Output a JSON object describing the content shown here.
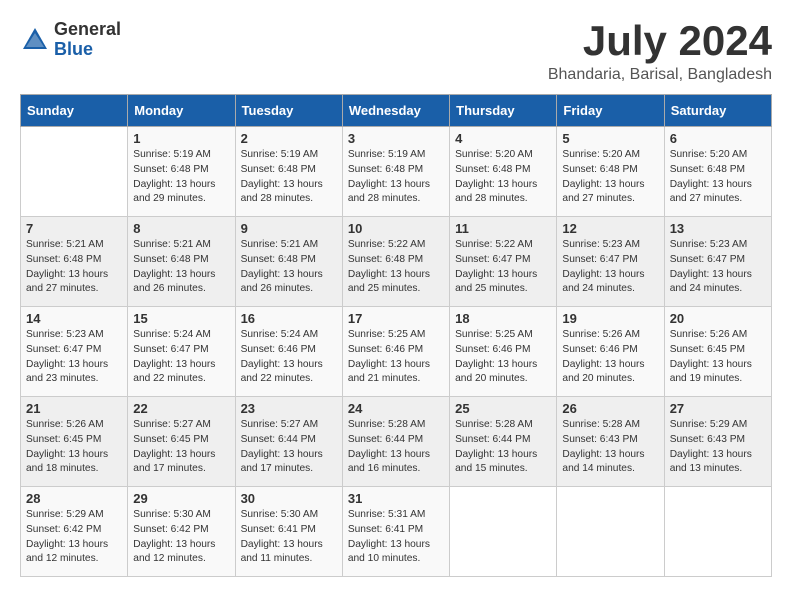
{
  "header": {
    "logo_general": "General",
    "logo_blue": "Blue",
    "month_year": "July 2024",
    "location": "Bhandaria, Barisal, Bangladesh"
  },
  "days_of_week": [
    "Sunday",
    "Monday",
    "Tuesday",
    "Wednesday",
    "Thursday",
    "Friday",
    "Saturday"
  ],
  "weeks": [
    [
      {
        "day": "",
        "content": ""
      },
      {
        "day": "1",
        "content": "Sunrise: 5:19 AM\nSunset: 6:48 PM\nDaylight: 13 hours\nand 29 minutes."
      },
      {
        "day": "2",
        "content": "Sunrise: 5:19 AM\nSunset: 6:48 PM\nDaylight: 13 hours\nand 28 minutes."
      },
      {
        "day": "3",
        "content": "Sunrise: 5:19 AM\nSunset: 6:48 PM\nDaylight: 13 hours\nand 28 minutes."
      },
      {
        "day": "4",
        "content": "Sunrise: 5:20 AM\nSunset: 6:48 PM\nDaylight: 13 hours\nand 28 minutes."
      },
      {
        "day": "5",
        "content": "Sunrise: 5:20 AM\nSunset: 6:48 PM\nDaylight: 13 hours\nand 27 minutes."
      },
      {
        "day": "6",
        "content": "Sunrise: 5:20 AM\nSunset: 6:48 PM\nDaylight: 13 hours\nand 27 minutes."
      }
    ],
    [
      {
        "day": "7",
        "content": "Sunrise: 5:21 AM\nSunset: 6:48 PM\nDaylight: 13 hours\nand 27 minutes."
      },
      {
        "day": "8",
        "content": "Sunrise: 5:21 AM\nSunset: 6:48 PM\nDaylight: 13 hours\nand 26 minutes."
      },
      {
        "day": "9",
        "content": "Sunrise: 5:21 AM\nSunset: 6:48 PM\nDaylight: 13 hours\nand 26 minutes."
      },
      {
        "day": "10",
        "content": "Sunrise: 5:22 AM\nSunset: 6:48 PM\nDaylight: 13 hours\nand 25 minutes."
      },
      {
        "day": "11",
        "content": "Sunrise: 5:22 AM\nSunset: 6:47 PM\nDaylight: 13 hours\nand 25 minutes."
      },
      {
        "day": "12",
        "content": "Sunrise: 5:23 AM\nSunset: 6:47 PM\nDaylight: 13 hours\nand 24 minutes."
      },
      {
        "day": "13",
        "content": "Sunrise: 5:23 AM\nSunset: 6:47 PM\nDaylight: 13 hours\nand 24 minutes."
      }
    ],
    [
      {
        "day": "14",
        "content": "Sunrise: 5:23 AM\nSunset: 6:47 PM\nDaylight: 13 hours\nand 23 minutes."
      },
      {
        "day": "15",
        "content": "Sunrise: 5:24 AM\nSunset: 6:47 PM\nDaylight: 13 hours\nand 22 minutes."
      },
      {
        "day": "16",
        "content": "Sunrise: 5:24 AM\nSunset: 6:46 PM\nDaylight: 13 hours\nand 22 minutes."
      },
      {
        "day": "17",
        "content": "Sunrise: 5:25 AM\nSunset: 6:46 PM\nDaylight: 13 hours\nand 21 minutes."
      },
      {
        "day": "18",
        "content": "Sunrise: 5:25 AM\nSunset: 6:46 PM\nDaylight: 13 hours\nand 20 minutes."
      },
      {
        "day": "19",
        "content": "Sunrise: 5:26 AM\nSunset: 6:46 PM\nDaylight: 13 hours\nand 20 minutes."
      },
      {
        "day": "20",
        "content": "Sunrise: 5:26 AM\nSunset: 6:45 PM\nDaylight: 13 hours\nand 19 minutes."
      }
    ],
    [
      {
        "day": "21",
        "content": "Sunrise: 5:26 AM\nSunset: 6:45 PM\nDaylight: 13 hours\nand 18 minutes."
      },
      {
        "day": "22",
        "content": "Sunrise: 5:27 AM\nSunset: 6:45 PM\nDaylight: 13 hours\nand 17 minutes."
      },
      {
        "day": "23",
        "content": "Sunrise: 5:27 AM\nSunset: 6:44 PM\nDaylight: 13 hours\nand 17 minutes."
      },
      {
        "day": "24",
        "content": "Sunrise: 5:28 AM\nSunset: 6:44 PM\nDaylight: 13 hours\nand 16 minutes."
      },
      {
        "day": "25",
        "content": "Sunrise: 5:28 AM\nSunset: 6:44 PM\nDaylight: 13 hours\nand 15 minutes."
      },
      {
        "day": "26",
        "content": "Sunrise: 5:28 AM\nSunset: 6:43 PM\nDaylight: 13 hours\nand 14 minutes."
      },
      {
        "day": "27",
        "content": "Sunrise: 5:29 AM\nSunset: 6:43 PM\nDaylight: 13 hours\nand 13 minutes."
      }
    ],
    [
      {
        "day": "28",
        "content": "Sunrise: 5:29 AM\nSunset: 6:42 PM\nDaylight: 13 hours\nand 12 minutes."
      },
      {
        "day": "29",
        "content": "Sunrise: 5:30 AM\nSunset: 6:42 PM\nDaylight: 13 hours\nand 12 minutes."
      },
      {
        "day": "30",
        "content": "Sunrise: 5:30 AM\nSunset: 6:41 PM\nDaylight: 13 hours\nand 11 minutes."
      },
      {
        "day": "31",
        "content": "Sunrise: 5:31 AM\nSunset: 6:41 PM\nDaylight: 13 hours\nand 10 minutes."
      },
      {
        "day": "",
        "content": ""
      },
      {
        "day": "",
        "content": ""
      },
      {
        "day": "",
        "content": ""
      }
    ]
  ]
}
